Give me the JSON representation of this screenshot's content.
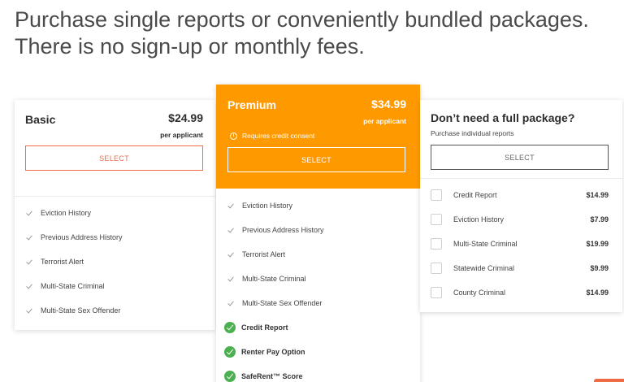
{
  "headline": {
    "line1": "Purchase single reports or conveniently bundled packages.",
    "line2": "There is no sign-up or monthly fees."
  },
  "basic": {
    "title": "Basic",
    "price": "$24.99",
    "per": "per applicant",
    "select_label": "SELECT",
    "features": [
      "Eviction History",
      "Previous Address History",
      "Terrorist Alert",
      "Multi-State Criminal",
      "Multi-State Sex Offender"
    ]
  },
  "premium": {
    "title": "Premium",
    "price": "$34.99",
    "per": "per applicant",
    "consent": "Requires credit consent",
    "select_label": "SELECT",
    "features": [
      "Eviction History",
      "Previous Address History",
      "Terrorist Alert",
      "Multi-State Criminal",
      "Multi-State Sex Offender"
    ],
    "extras": [
      "Credit Report",
      "Renter Pay Option",
      "SafeRent™ Score"
    ]
  },
  "individual": {
    "title": "Don’t need a full package?",
    "subtitle": "Purchase individual reports",
    "select_label": "SELECT",
    "items": [
      {
        "name": "Credit Report",
        "price": "$14.99"
      },
      {
        "name": "Eviction History",
        "price": "$7.99"
      },
      {
        "name": "Multi-State Criminal",
        "price": "$19.99"
      },
      {
        "name": "Statewide Criminal",
        "price": "$9.99"
      },
      {
        "name": "County Criminal",
        "price": "$14.99"
      }
    ]
  },
  "colors": {
    "accent": "#ff9900",
    "select_outline": "#ef6b46",
    "included_check": "#4caf50"
  }
}
